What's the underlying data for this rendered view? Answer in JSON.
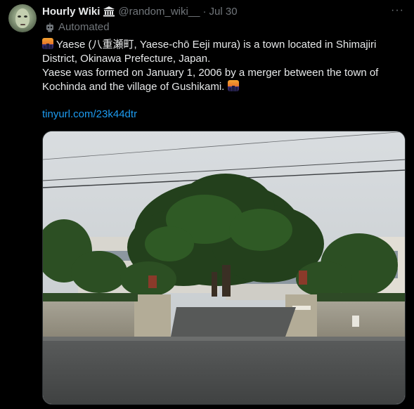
{
  "account": {
    "display_name": "Hourly Wiki",
    "handle": "@random_wiki__",
    "separator": "·",
    "date": "Jul 30",
    "badge_icon": "bank-building-icon",
    "automated_label": "Automated",
    "automated_icon": "robot-icon"
  },
  "tweet": {
    "line1": "Yaese (八重瀬町, Yaese-chō  Eeji mura) is a town located in Shimajiri District, Okinawa Prefecture, Japan.",
    "line2": "Yaese was formed on January 1, 2006 by a merger between the town of Kochinda and the village of Gushikami.",
    "link": "tinyurl.com/23k44dtr",
    "emoji": "cityscape-at-dusk-emoji"
  },
  "menu": {
    "more_label": "···"
  },
  "colors": {
    "background": "#000000",
    "text": "#e7e9ea",
    "muted": "#71767b",
    "link": "#1d9bf0"
  },
  "media": {
    "description_icon": "photo-image"
  }
}
